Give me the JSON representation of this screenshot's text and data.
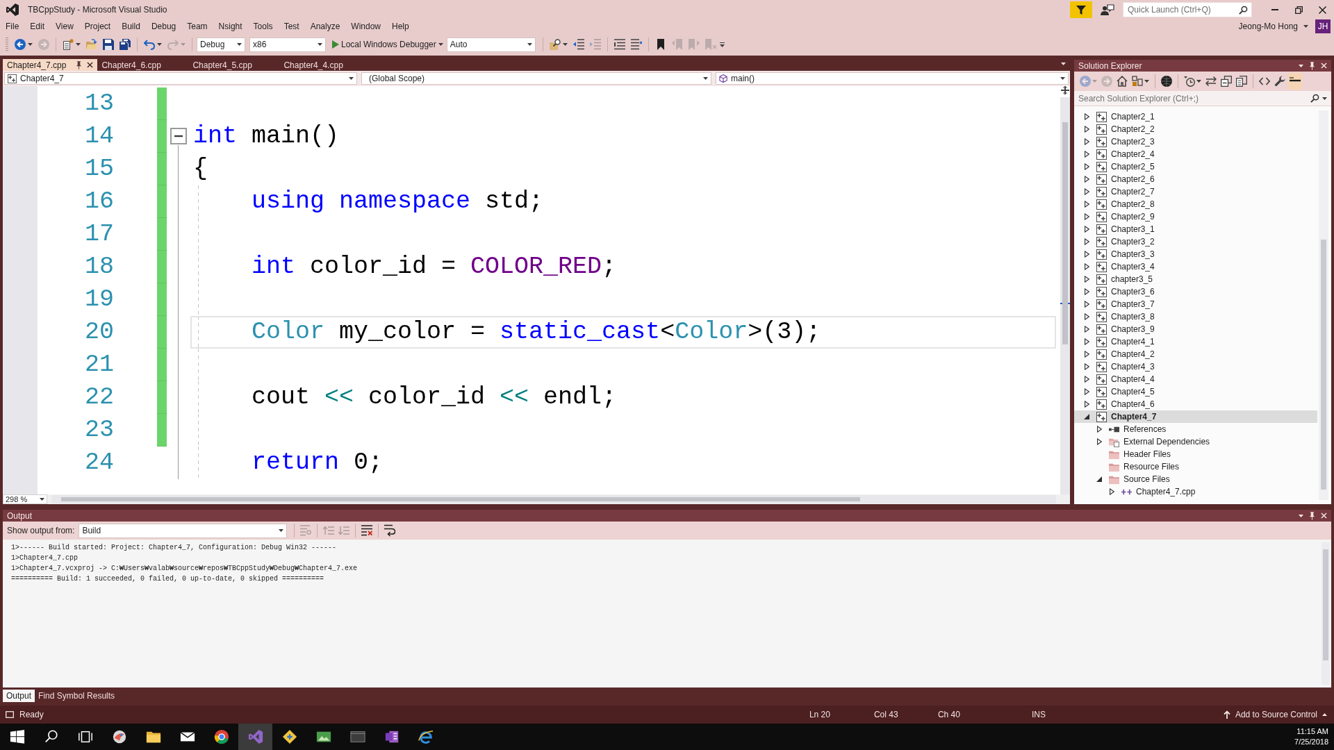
{
  "window": {
    "title": "TBCppStudy - Microsoft Visual Studio"
  },
  "quick_launch": {
    "placeholder": "Quick Launch (Ctrl+Q)"
  },
  "menu": [
    "File",
    "Edit",
    "View",
    "Project",
    "Build",
    "Debug",
    "Team",
    "Nsight",
    "Tools",
    "Test",
    "Analyze",
    "Window",
    "Help"
  ],
  "account": {
    "name": "Jeong-Mo Hong",
    "initials": "JH"
  },
  "toolbar": [
    {
      "kind": "back",
      "disabled": false
    },
    {
      "kind": "forward",
      "disabled": true
    },
    {
      "kind": "new-project",
      "disabled": false
    },
    {
      "kind": "open",
      "disabled": false
    },
    {
      "kind": "save",
      "disabled": false
    },
    {
      "kind": "save-all",
      "disabled": false
    },
    {
      "kind": "undo",
      "disabled": false
    },
    {
      "kind": "redo",
      "disabled": true
    },
    {
      "kind": "dropdown",
      "value": "Debug"
    },
    {
      "kind": "dropdown",
      "value": "x86"
    },
    {
      "kind": "start",
      "label": "Local Windows Debugger"
    },
    {
      "kind": "dropdown",
      "value": "Auto"
    },
    {
      "kind": "find-in-files",
      "disabled": false
    },
    {
      "kind": "outdent",
      "disabled": false
    },
    {
      "kind": "indent",
      "disabled": true
    },
    {
      "kind": "comment",
      "disabled": false
    },
    {
      "kind": "uncomment",
      "disabled": false
    },
    {
      "kind": "bookmark",
      "disabled": false
    },
    {
      "kind": "bookmark-prev",
      "disabled": true
    },
    {
      "kind": "bookmark-next",
      "disabled": true
    },
    {
      "kind": "bookmark-clear",
      "disabled": true
    }
  ],
  "tabs": [
    {
      "label": "Chapter4_7.cpp",
      "selected": true
    },
    {
      "label": "Chapter4_6.cpp",
      "selected": false
    },
    {
      "label": "Chapter4_5.cpp",
      "selected": false
    },
    {
      "label": "Chapter4_4.cpp",
      "selected": false
    }
  ],
  "navigation": {
    "project": "Chapter4_7",
    "scope": "(Global Scope)",
    "member": "main()"
  },
  "editor": {
    "zoom": "298 %",
    "lines": [
      {
        "number": "13",
        "modified": true,
        "fold": false,
        "current": false
      },
      {
        "number": "14",
        "modified": true,
        "fold": true,
        "current": false,
        "tokens": [
          {
            "kind": "keyword",
            "text": "int"
          },
          {
            "kind": "plain",
            "text": " main()"
          }
        ]
      },
      {
        "number": "15",
        "modified": true,
        "fold": false,
        "current": false,
        "tokens": [
          {
            "kind": "plain",
            "text": "{"
          }
        ]
      },
      {
        "number": "16",
        "modified": true,
        "fold": false,
        "current": false,
        "tokens": [
          {
            "kind": "keyword",
            "text": "    using namespace"
          },
          {
            "kind": "plain",
            "text": " std;"
          }
        ]
      },
      {
        "number": "17",
        "modified": true,
        "fold": false,
        "current": false
      },
      {
        "number": "18",
        "modified": true,
        "fold": false,
        "current": false,
        "tokens": [
          {
            "kind": "keyword",
            "text": "    int"
          },
          {
            "kind": "plain",
            "text": " color_id = "
          },
          {
            "kind": "macro",
            "text": "COLOR_RED"
          },
          {
            "kind": "plain",
            "text": ";"
          }
        ]
      },
      {
        "number": "19",
        "modified": true,
        "fold": false,
        "current": false
      },
      {
        "number": "20",
        "modified": true,
        "fold": false,
        "current": true,
        "tokens": [
          {
            "kind": "type",
            "text": "    Color"
          },
          {
            "kind": "plain",
            "text": " my_color = "
          },
          {
            "kind": "keyword",
            "text": "static_cast"
          },
          {
            "kind": "plain",
            "text": "<"
          },
          {
            "kind": "type",
            "text": "Color"
          },
          {
            "kind": "plain",
            "text": ">(3);"
          }
        ]
      },
      {
        "number": "21",
        "modified": true,
        "fold": false,
        "current": false
      },
      {
        "number": "22",
        "modified": true,
        "fold": false,
        "current": false,
        "tokens": [
          {
            "kind": "plain",
            "text": "    cout "
          },
          {
            "kind": "operator",
            "text": "<<"
          },
          {
            "kind": "plain",
            "text": " color_id "
          },
          {
            "kind": "operator",
            "text": "<<"
          },
          {
            "kind": "plain",
            "text": " endl;"
          }
        ]
      },
      {
        "number": "23",
        "modified": true,
        "fold": false,
        "current": false
      },
      {
        "number": "24",
        "modified": false,
        "fold": false,
        "current": false,
        "tokens": [
          {
            "kind": "keyword",
            "text": "    return"
          },
          {
            "kind": "plain",
            "text": " 0;"
          }
        ]
      }
    ]
  },
  "solution_explorer": {
    "title": "Solution Explorer",
    "toolbar": [
      {
        "kind": "back",
        "disabled": true,
        "on": false
      },
      {
        "kind": "forward",
        "disabled": true,
        "on": false
      },
      {
        "kind": "home",
        "disabled": false,
        "on": false
      },
      {
        "kind": "switch-views",
        "disabled": false,
        "on": false
      },
      {
        "kind": "sphere",
        "disabled": false,
        "on": false
      },
      {
        "kind": "clock",
        "disabled": false,
        "on": false
      },
      {
        "kind": "sync",
        "disabled": false,
        "on": false
      },
      {
        "kind": "collapse-all",
        "disabled": false,
        "on": false
      },
      {
        "kind": "show-all-files",
        "disabled": false,
        "on": false
      },
      {
        "kind": "view-code",
        "disabled": false,
        "on": false
      },
      {
        "kind": "properties",
        "disabled": false,
        "on": false
      },
      {
        "kind": "preview",
        "disabled": false,
        "on": true
      }
    ],
    "search": {
      "placeholder": "Search Solution Explorer (Ctrl+;)"
    },
    "tree": [
      {
        "label": "Chapter2_1",
        "kind": "project",
        "expanded": false,
        "selected": false,
        "startup": false
      },
      {
        "label": "Chapter2_2",
        "kind": "project",
        "expanded": false,
        "selected": false,
        "startup": false
      },
      {
        "label": "Chapter2_3",
        "kind": "project",
        "expanded": false,
        "selected": false,
        "startup": false
      },
      {
        "label": "Chapter2_4",
        "kind": "project",
        "expanded": false,
        "selected": false,
        "startup": false
      },
      {
        "label": "Chapter2_5",
        "kind": "project",
        "expanded": false,
        "selected": false,
        "startup": false
      },
      {
        "label": "Chapter2_6",
        "kind": "project",
        "expanded": false,
        "selected": false,
        "startup": false
      },
      {
        "label": "Chapter2_7",
        "kind": "project",
        "expanded": false,
        "selected": false,
        "startup": false
      },
      {
        "label": "Chapter2_8",
        "kind": "project",
        "expanded": false,
        "selected": false,
        "startup": false
      },
      {
        "label": "Chapter2_9",
        "kind": "project",
        "expanded": false,
        "selected": false,
        "startup": false
      },
      {
        "label": "Chapter3_1",
        "kind": "project",
        "expanded": false,
        "selected": false,
        "startup": false
      },
      {
        "label": "Chapter3_2",
        "kind": "project",
        "expanded": false,
        "selected": false,
        "startup": false
      },
      {
        "label": "Chapter3_3",
        "kind": "project",
        "expanded": false,
        "selected": false,
        "startup": false
      },
      {
        "label": "Chapter3_4",
        "kind": "project",
        "expanded": false,
        "selected": false,
        "startup": false
      },
      {
        "label": "chapter3_5",
        "kind": "project",
        "expanded": false,
        "selected": false,
        "startup": false
      },
      {
        "label": "Chapter3_6",
        "kind": "project",
        "expanded": false,
        "selected": false,
        "startup": false
      },
      {
        "label": "Chapter3_7",
        "kind": "project",
        "expanded": false,
        "selected": false,
        "startup": false
      },
      {
        "label": "Chapter3_8",
        "kind": "project",
        "expanded": false,
        "selected": false,
        "startup": false
      },
      {
        "label": "Chapter3_9",
        "kind": "project",
        "expanded": false,
        "selected": false,
        "startup": false
      },
      {
        "label": "Chapter4_1",
        "kind": "project",
        "expanded": false,
        "selected": false,
        "startup": false
      },
      {
        "label": "Chapter4_2",
        "kind": "project",
        "expanded": false,
        "selected": false,
        "startup": false
      },
      {
        "label": "Chapter4_3",
        "kind": "project",
        "expanded": false,
        "selected": false,
        "startup": false
      },
      {
        "label": "Chapter4_4",
        "kind": "project",
        "expanded": false,
        "selected": false,
        "startup": false
      },
      {
        "label": "Chapter4_5",
        "kind": "project",
        "expanded": false,
        "selected": false,
        "startup": false
      },
      {
        "label": "Chapter4_6",
        "kind": "project",
        "expanded": false,
        "selected": false,
        "startup": false
      },
      {
        "label": "Chapter4_7",
        "kind": "project",
        "expanded": true,
        "selected": true,
        "startup": true,
        "children": [
          {
            "label": "References",
            "kind": "references",
            "expanded": false,
            "selected": false
          },
          {
            "label": "External Dependencies",
            "kind": "dependencies",
            "expanded": false,
            "selected": false
          },
          {
            "label": "Header Files",
            "kind": "filter",
            "selected": false
          },
          {
            "label": "Resource Files",
            "kind": "filter",
            "selected": false
          },
          {
            "label": "Source Files",
            "kind": "filter",
            "expanded": true,
            "selected": false,
            "children": [
              {
                "label": "Chapter4_7.cpp",
                "kind": "cpp",
                "expanded": false,
                "selected": false
              }
            ]
          }
        ]
      }
    ]
  },
  "output": {
    "title": "Output",
    "source_label": "Show output from:",
    "source": "Build",
    "toolbar": [
      {
        "kind": "find-message",
        "disabled": true
      },
      {
        "kind": "prev-message",
        "disabled": true
      },
      {
        "kind": "next-message",
        "disabled": true
      },
      {
        "kind": "clear-all",
        "disabled": false
      },
      {
        "kind": "word-wrap",
        "disabled": false
      }
    ],
    "lines": [
      "1>------ Build started: Project: Chapter4_7, Configuration: Debug Win32 ------",
      "1>Chapter4_7.cpp",
      "1>Chapter4_7.vcxproj -> C:₩Users₩valab₩source₩repos₩TBCppStudy₩Debug₩Chapter4_7.exe",
      "========== Build: 1 succeeded, 0 failed, 0 up-to-date, 0 skipped =========="
    ]
  },
  "panel_tabs": [
    {
      "label": "Output",
      "selected": true
    },
    {
      "label": "Find Symbol Results",
      "selected": false
    }
  ],
  "status_bar": {
    "message": "Ready",
    "line": "Ln 20",
    "column": "Col 43",
    "character": "Ch 40",
    "mode": "INS",
    "source_control": "Add to Source Control"
  },
  "taskbar": {
    "items": [
      {
        "kind": "start",
        "selected": false
      },
      {
        "kind": "search",
        "selected": false
      },
      {
        "kind": "task-view",
        "selected": false
      },
      {
        "kind": "bird",
        "selected": false
      },
      {
        "kind": "folder",
        "selected": false
      },
      {
        "kind": "mail",
        "selected": false
      },
      {
        "kind": "circle",
        "selected": false
      },
      {
        "kind": "studio",
        "selected": true
      },
      {
        "kind": "diamond",
        "selected": false
      },
      {
        "kind": "photo",
        "selected": false
      },
      {
        "kind": "window",
        "selected": false
      },
      {
        "kind": "notebook",
        "selected": false
      },
      {
        "kind": "ring",
        "selected": false
      }
    ],
    "time": "11:15 AM",
    "date": "7/25/2018"
  }
}
